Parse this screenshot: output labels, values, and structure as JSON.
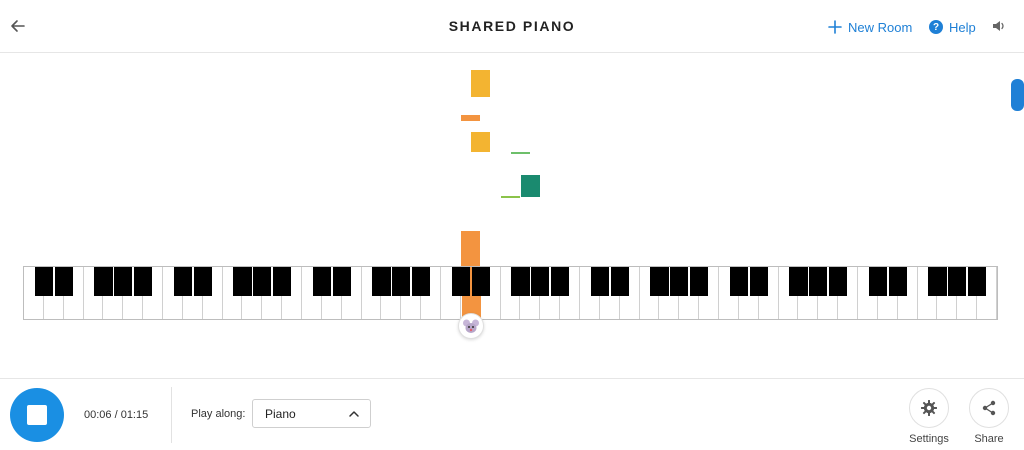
{
  "header": {
    "title": "SHARED PIANO",
    "new_room_label": "New Room",
    "help_label": "Help",
    "help_glyph": "?"
  },
  "colors": {
    "accent": "#1f80d6",
    "stop_button": "#1a8fe3",
    "note_yellow": "#f3b431",
    "note_orange": "#f39440",
    "note_green": "#1a8a6f",
    "note_light_green": "#8bc34a"
  },
  "footer": {
    "time_display": "00:06 / 01:15",
    "play_along_label": "Play along:",
    "instrument_selected": "Piano",
    "settings_label": "Settings",
    "share_label": "Share"
  },
  "icons": {
    "back": "arrow-left-icon",
    "new_room": "plus-icon",
    "help": "question-circle-icon",
    "sound": "speaker-icon",
    "stop": "stop-icon",
    "dropdown": "chevron-up-icon",
    "settings": "gear-icon",
    "share": "share-icon",
    "avatar": "mouse-icon"
  },
  "playback": {
    "elapsed": "00:06",
    "total": "01:15"
  }
}
